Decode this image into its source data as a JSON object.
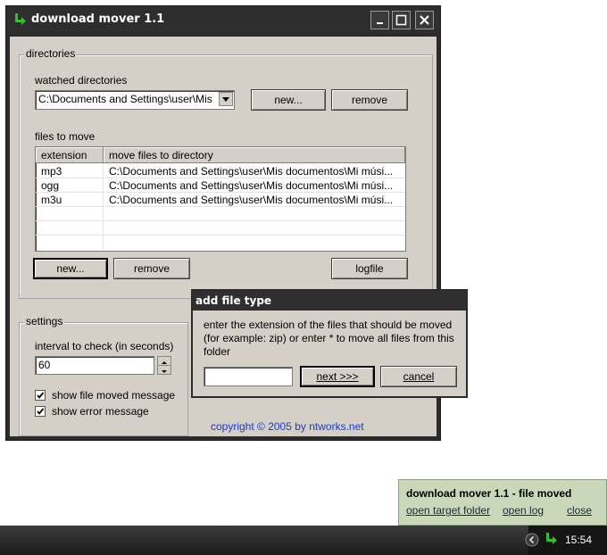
{
  "window": {
    "title": "download mover 1.1"
  },
  "directories": {
    "group_label": "directories",
    "watched_label": "watched directories",
    "watched_value": "C:\\Documents and Settings\\user\\Mis",
    "new_label": "new...",
    "remove_label": "remove",
    "files_label": "files to move",
    "columns": [
      "extension",
      "move files to directory"
    ],
    "rows": [
      {
        "ext": "mp3",
        "dir": "C:\\Documents and Settings\\user\\Mis documentos\\Mi músi..."
      },
      {
        "ext": "ogg",
        "dir": "C:\\Documents and Settings\\user\\Mis documentos\\Mi músi..."
      },
      {
        "ext": "m3u",
        "dir": "C:\\Documents and Settings\\user\\Mis documentos\\Mi músi..."
      }
    ],
    "files_new_label": "new...",
    "files_remove_label": "remove",
    "logfile_label": "logfile"
  },
  "settings": {
    "group_label": "settings",
    "interval_label": "interval to check (in seconds)",
    "interval_value": "60",
    "show_moved_label": "show file moved message",
    "show_moved_checked": true,
    "show_error_label": "show error message",
    "show_error_checked": true
  },
  "copyright": "copyright © 2005 by ntworks.net",
  "dialog": {
    "title": "add file type",
    "message": "enter the extension of the files that should be moved (for example: zip) or enter * to move all files from this folder",
    "input_value": "",
    "next_label": "next >>>",
    "cancel_label": "cancel"
  },
  "notification": {
    "title": "download mover 1.1 - file moved",
    "open_folder": "open target folder",
    "open_log": "open log",
    "close": "close"
  },
  "taskbar": {
    "clock": "15:54"
  },
  "colors": {
    "accent_green": "#22aa22",
    "link_blue": "#1a3ccc"
  }
}
